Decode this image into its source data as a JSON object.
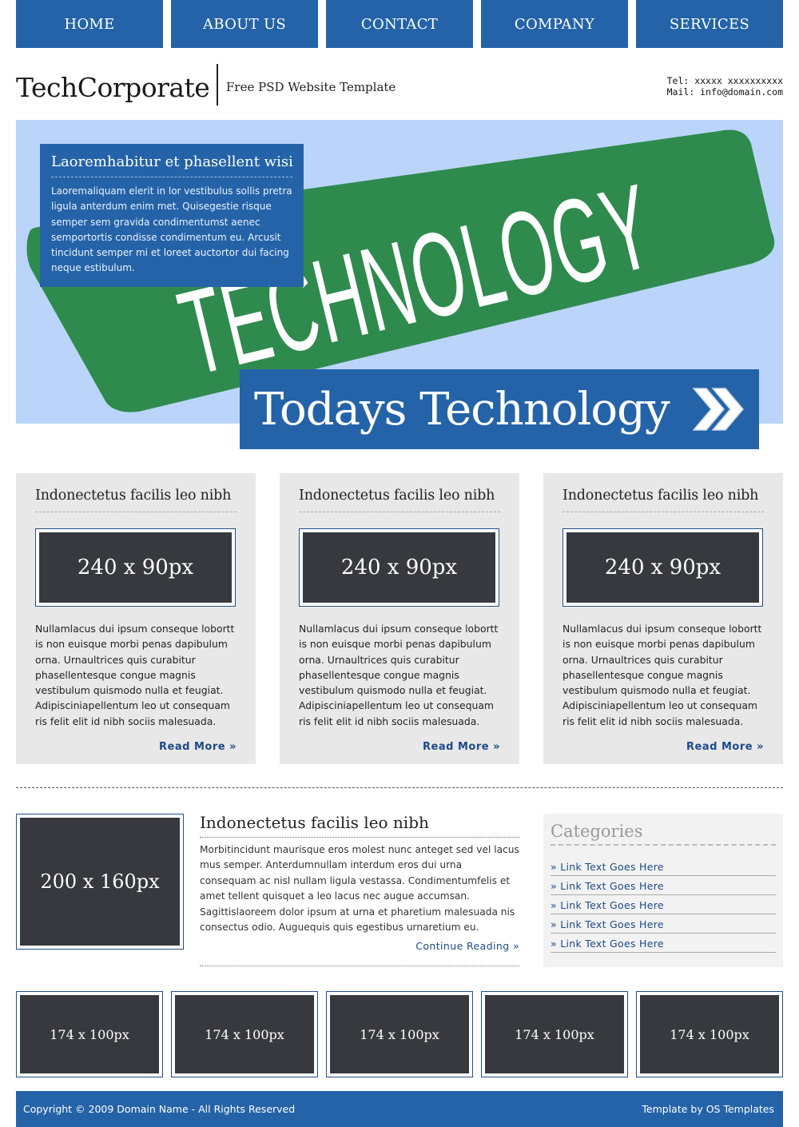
{
  "nav": {
    "items": [
      {
        "label": "HOME"
      },
      {
        "label": "ABOUT US"
      },
      {
        "label": "CONTACT"
      },
      {
        "label": "COMPANY"
      },
      {
        "label": "SERVICES"
      }
    ]
  },
  "header": {
    "logo": "TechCorporate",
    "tagline": "Free PSD Website Template",
    "tel": "Tel: xxxxx xxxxxxxxxx",
    "mail": "Mail: info@domain.com"
  },
  "hero": {
    "sign_word": "TECHNOLOGY",
    "box_title": "Laoremhabitur et phasellent wisi",
    "box_text": "Laoremaliquam elerit in lor vestibulus sollis pretra ligula anterdum enim met. Quisegestie risque semper sem gravida condimentumst aenec semportortis condisse condimentum eu. Arcusit tincidunt semper mi et loreet auctortor dui facing neque estibulum.",
    "cta_text": "Todays Technology",
    "colors": {
      "sky": "#bad5f9",
      "sign": "#2f8a4e",
      "blue": "#2563a8"
    }
  },
  "features": [
    {
      "title": "Indonectetus facilis leo nibh",
      "image_label": "240 x 90px",
      "text": "Nullamlacus dui ipsum conseque lobortt is non euisque morbi penas dapibulum orna. Urnaultrices quis curabitur phasellentesque congue magnis vestibulum quismodo nulla et feugiat. Adipisciniapellentum leo ut consequam ris felit elit id nibh sociis malesuada.",
      "link": "Read More »"
    },
    {
      "title": "Indonectetus facilis leo nibh",
      "image_label": "240 x 90px",
      "text": "Nullamlacus dui ipsum conseque lobortt is non euisque morbi penas dapibulum orna. Urnaultrices quis curabitur phasellentesque congue magnis vestibulum quismodo nulla et feugiat. Adipisciniapellentum leo ut consequam ris felit elit id nibh sociis malesuada.",
      "link": "Read More »"
    },
    {
      "title": "Indonectetus facilis leo nibh",
      "image_label": "240 x 90px",
      "text": "Nullamlacus dui ipsum conseque lobortt is non euisque morbi penas dapibulum orna. Urnaultrices quis curabitur phasellentesque congue magnis vestibulum quismodo nulla et feugiat. Adipisciniapellentum leo ut consequam ris felit elit id nibh sociis malesuada.",
      "link": "Read More »"
    }
  ],
  "article": {
    "image_label": "200 x 160px",
    "title": "Indonectetus facilis leo nibh",
    "text": "Morbitincidunt maurisque eros molest nunc anteget sed vel lacus mus semper. Anterdumnullam interdum eros dui urna consequam ac nisl nullam ligula vestassa. Condimentumfelis et amet tellent quisquet a leo lacus nec augue accumsan. Sagittislaoreem dolor ipsum at urna et pharetium malesuada nis consectus odio. Auguequis quis egestibus urnaretium eu.",
    "link": "Continue Reading »"
  },
  "sidebar": {
    "title": "Categories",
    "items": [
      {
        "label": "» Link Text Goes Here"
      },
      {
        "label": "» Link Text Goes Here"
      },
      {
        "label": "» Link Text Goes Here"
      },
      {
        "label": "» Link Text Goes Here"
      },
      {
        "label": "» Link Text Goes Here"
      }
    ]
  },
  "thumbs": [
    {
      "label": "174 x 100px"
    },
    {
      "label": "174 x 100px"
    },
    {
      "label": "174 x 100px"
    },
    {
      "label": "174 x 100px"
    },
    {
      "label": "174 x 100px"
    }
  ],
  "footer": {
    "copyright": "Copyright © 2009 Domain Name - All Rights Reserved",
    "credit": "Template by OS Templates"
  }
}
